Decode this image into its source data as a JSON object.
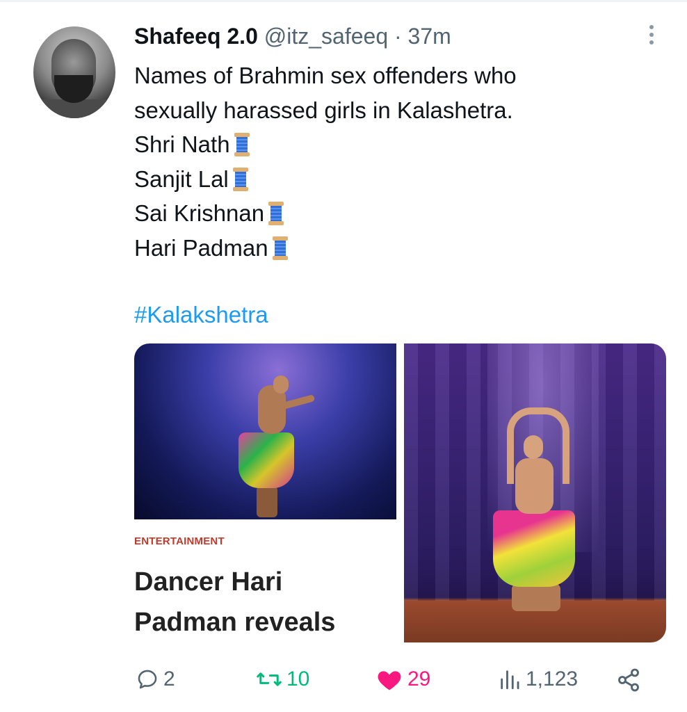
{
  "tweet": {
    "author_name": "Shafeeq 2.0",
    "handle": "@itz_safeeq",
    "separator": "·",
    "time": "37m",
    "lines": [
      "Names of Brahmin sex offenders who",
      "sexually harassed girls in Kalashetra.",
      "Shri Nath",
      "Sanjit Lal",
      "Sai Krishnan",
      "Hari Padman"
    ],
    "hashtag": "#Kalakshetra"
  },
  "media": {
    "card_category": "ENTERTAINMENT",
    "card_headline": "Dancer Hari Padman reveals"
  },
  "actions": {
    "replies": "2",
    "retweets": "10",
    "likes": "29",
    "views": "1,123"
  },
  "icons": {
    "spool": "spool-of-thread-icon",
    "reply": "reply-icon",
    "retweet": "retweet-icon",
    "like": "heart-icon",
    "views": "views-icon",
    "share": "share-icon",
    "more": "more-options-icon"
  },
  "colors": {
    "link": "#1d9bf0",
    "retweet": "#00ba7c",
    "like": "#f91880",
    "secondary_text": "#536471",
    "category": "#c0392b"
  }
}
